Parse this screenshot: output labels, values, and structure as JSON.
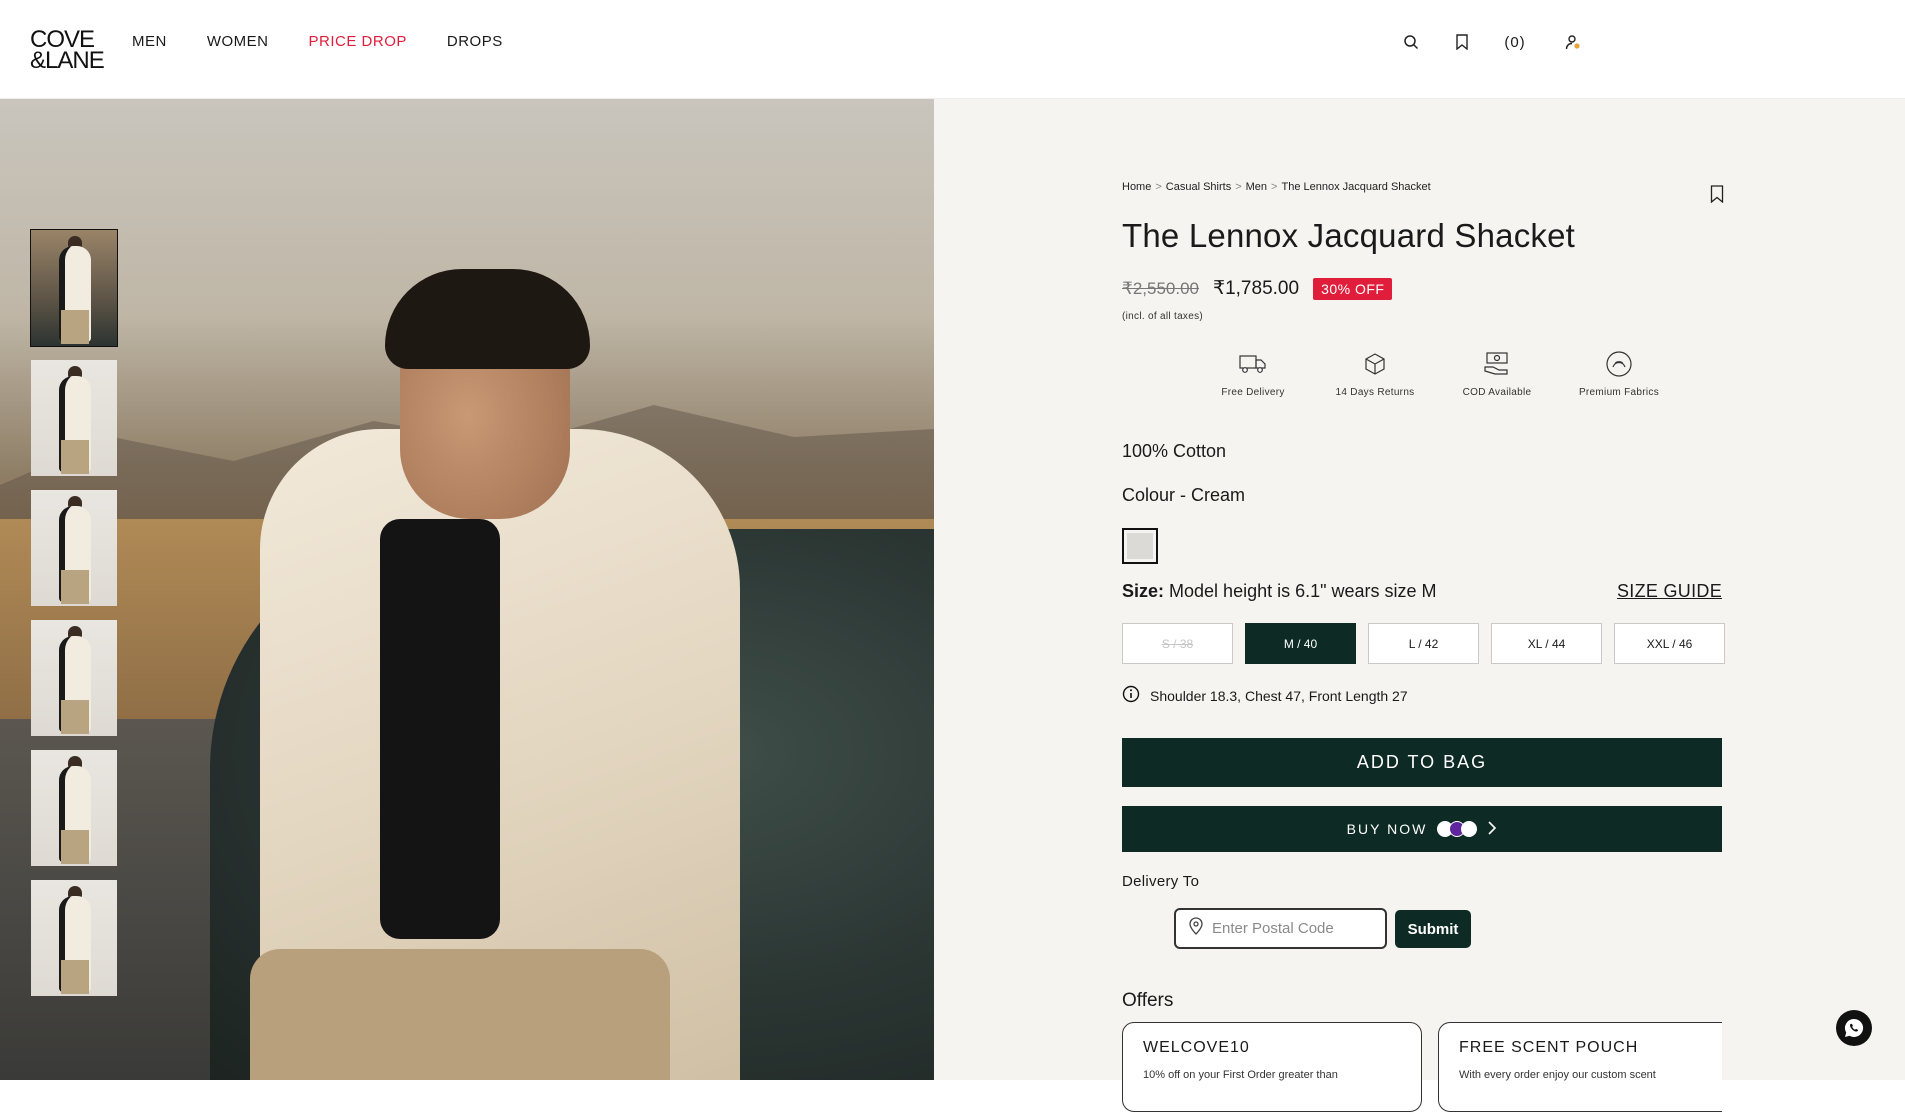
{
  "brand": {
    "line1": "COVE",
    "line2": "&LANE"
  },
  "nav": [
    {
      "label": "MEN"
    },
    {
      "label": "WOMEN"
    },
    {
      "label": "PRICE DROP"
    },
    {
      "label": "DROPS"
    }
  ],
  "header": {
    "cart_count": "(0)"
  },
  "breadcrumb": [
    "Home",
    "Casual Shirts",
    "Men",
    "The Lennox Jacquard Shacket"
  ],
  "breadcrumb_sep": ">",
  "product": {
    "title": "The Lennox Jacquard Shacket",
    "mrp": "₹2,550.00",
    "price": "₹1,785.00",
    "discount": "30% OFF",
    "tax_note": "(incl. of all taxes)",
    "material": "100% Cotton",
    "colour": "Colour - Cream",
    "size_label": "Size:",
    "size_note": "Model height is 6.1\" wears size M",
    "size_guide": "SIZE GUIDE",
    "measurements": "Shoulder 18.3, Chest 47, Front Length 27"
  },
  "features": [
    {
      "label": "Free Delivery",
      "icon": "truck-icon"
    },
    {
      "label": "14 Days Returns",
      "icon": "return-box-icon"
    },
    {
      "label": "COD Available",
      "icon": "cash-icon"
    },
    {
      "label": "Premium Fabrics",
      "icon": "fabric-icon"
    }
  ],
  "sizes": [
    {
      "label": "S / 38",
      "state": "disabled"
    },
    {
      "label": "M / 40",
      "state": "selected"
    },
    {
      "label": "L / 42",
      "state": "available"
    },
    {
      "label": "XL / 44",
      "state": "available"
    },
    {
      "label": "XXL / 46",
      "state": "available"
    }
  ],
  "actions": {
    "add_to_bag": "ADD TO BAG",
    "buy_now": "BUY NOW"
  },
  "delivery": {
    "label": "Delivery To",
    "placeholder": "Enter Postal Code",
    "submit": "Submit"
  },
  "offers": {
    "label": "Offers",
    "items": [
      {
        "code": "WELCOVE10",
        "desc": "10% off on your First Order greater than"
      },
      {
        "code": "FREE SCENT POUCH",
        "desc": "With every order enjoy our custom scent"
      }
    ]
  },
  "colors": {
    "accent_red": "#e01e3c",
    "primary_dark": "#0d2b24",
    "panel_bg": "#f5f4f0",
    "swatch_cream": "#dcdad6"
  }
}
